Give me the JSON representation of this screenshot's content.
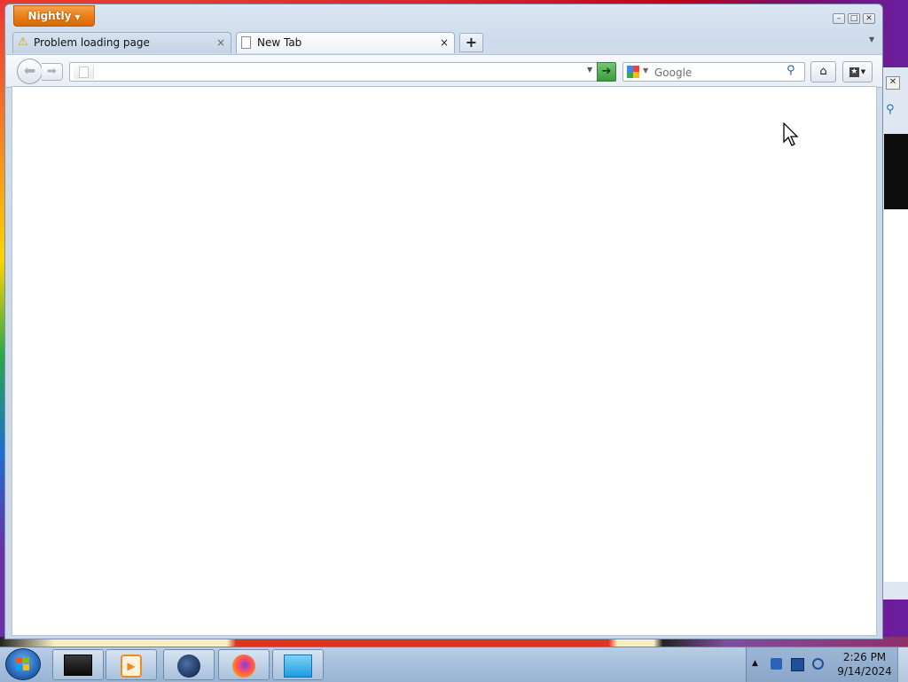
{
  "browser": {
    "app_menu_label": "Nightly",
    "tabs": [
      {
        "label": "Problem loading page",
        "icon": "warning-icon",
        "active": false
      },
      {
        "label": "New Tab",
        "icon": "page-icon",
        "active": true
      }
    ],
    "tab_close_glyph": "×",
    "new_tab_glyph": "+",
    "url": {
      "value": ""
    },
    "search": {
      "engine": "Google",
      "placeholder": "Google",
      "value": ""
    }
  },
  "taskbar": {
    "apps": [
      "terminal-app",
      "media-player-app",
      "globe-app",
      "firefox-app",
      "explorer-app"
    ],
    "clock": {
      "time": "2:26 PM",
      "date": "9/14/2024"
    }
  },
  "colors": {
    "app_button": "#e97d14",
    "go_button": "#3e9a3e",
    "taskbar": "#a7bfdc"
  }
}
